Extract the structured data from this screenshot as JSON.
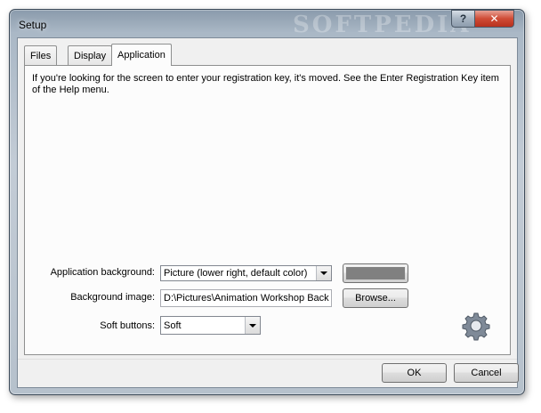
{
  "window": {
    "title": "Setup",
    "watermark": "SOFTPEDIA"
  },
  "caption_buttons": {
    "help": "?",
    "close": "✕"
  },
  "tabs": [
    {
      "label": "Files",
      "active": false
    },
    {
      "label": "Display",
      "active": false
    },
    {
      "label": "Application",
      "active": true
    }
  ],
  "notice": "If you're looking for the screen to enter your registration key, it's moved. See the Enter Registration Key item of the Help menu.",
  "app_background": {
    "label": "Application background:",
    "value": "Picture (lower right, default color)",
    "color": "#808080"
  },
  "background_image": {
    "label": "Background image:",
    "value": "D:\\Pictures\\Animation Workshop Back",
    "browse_label": "Browse..."
  },
  "soft_buttons": {
    "label": "Soft buttons:",
    "value": "Soft"
  },
  "icons": {
    "settings": "gear-icon"
  },
  "footer": {
    "ok_label": "OK",
    "cancel_label": "Cancel"
  }
}
